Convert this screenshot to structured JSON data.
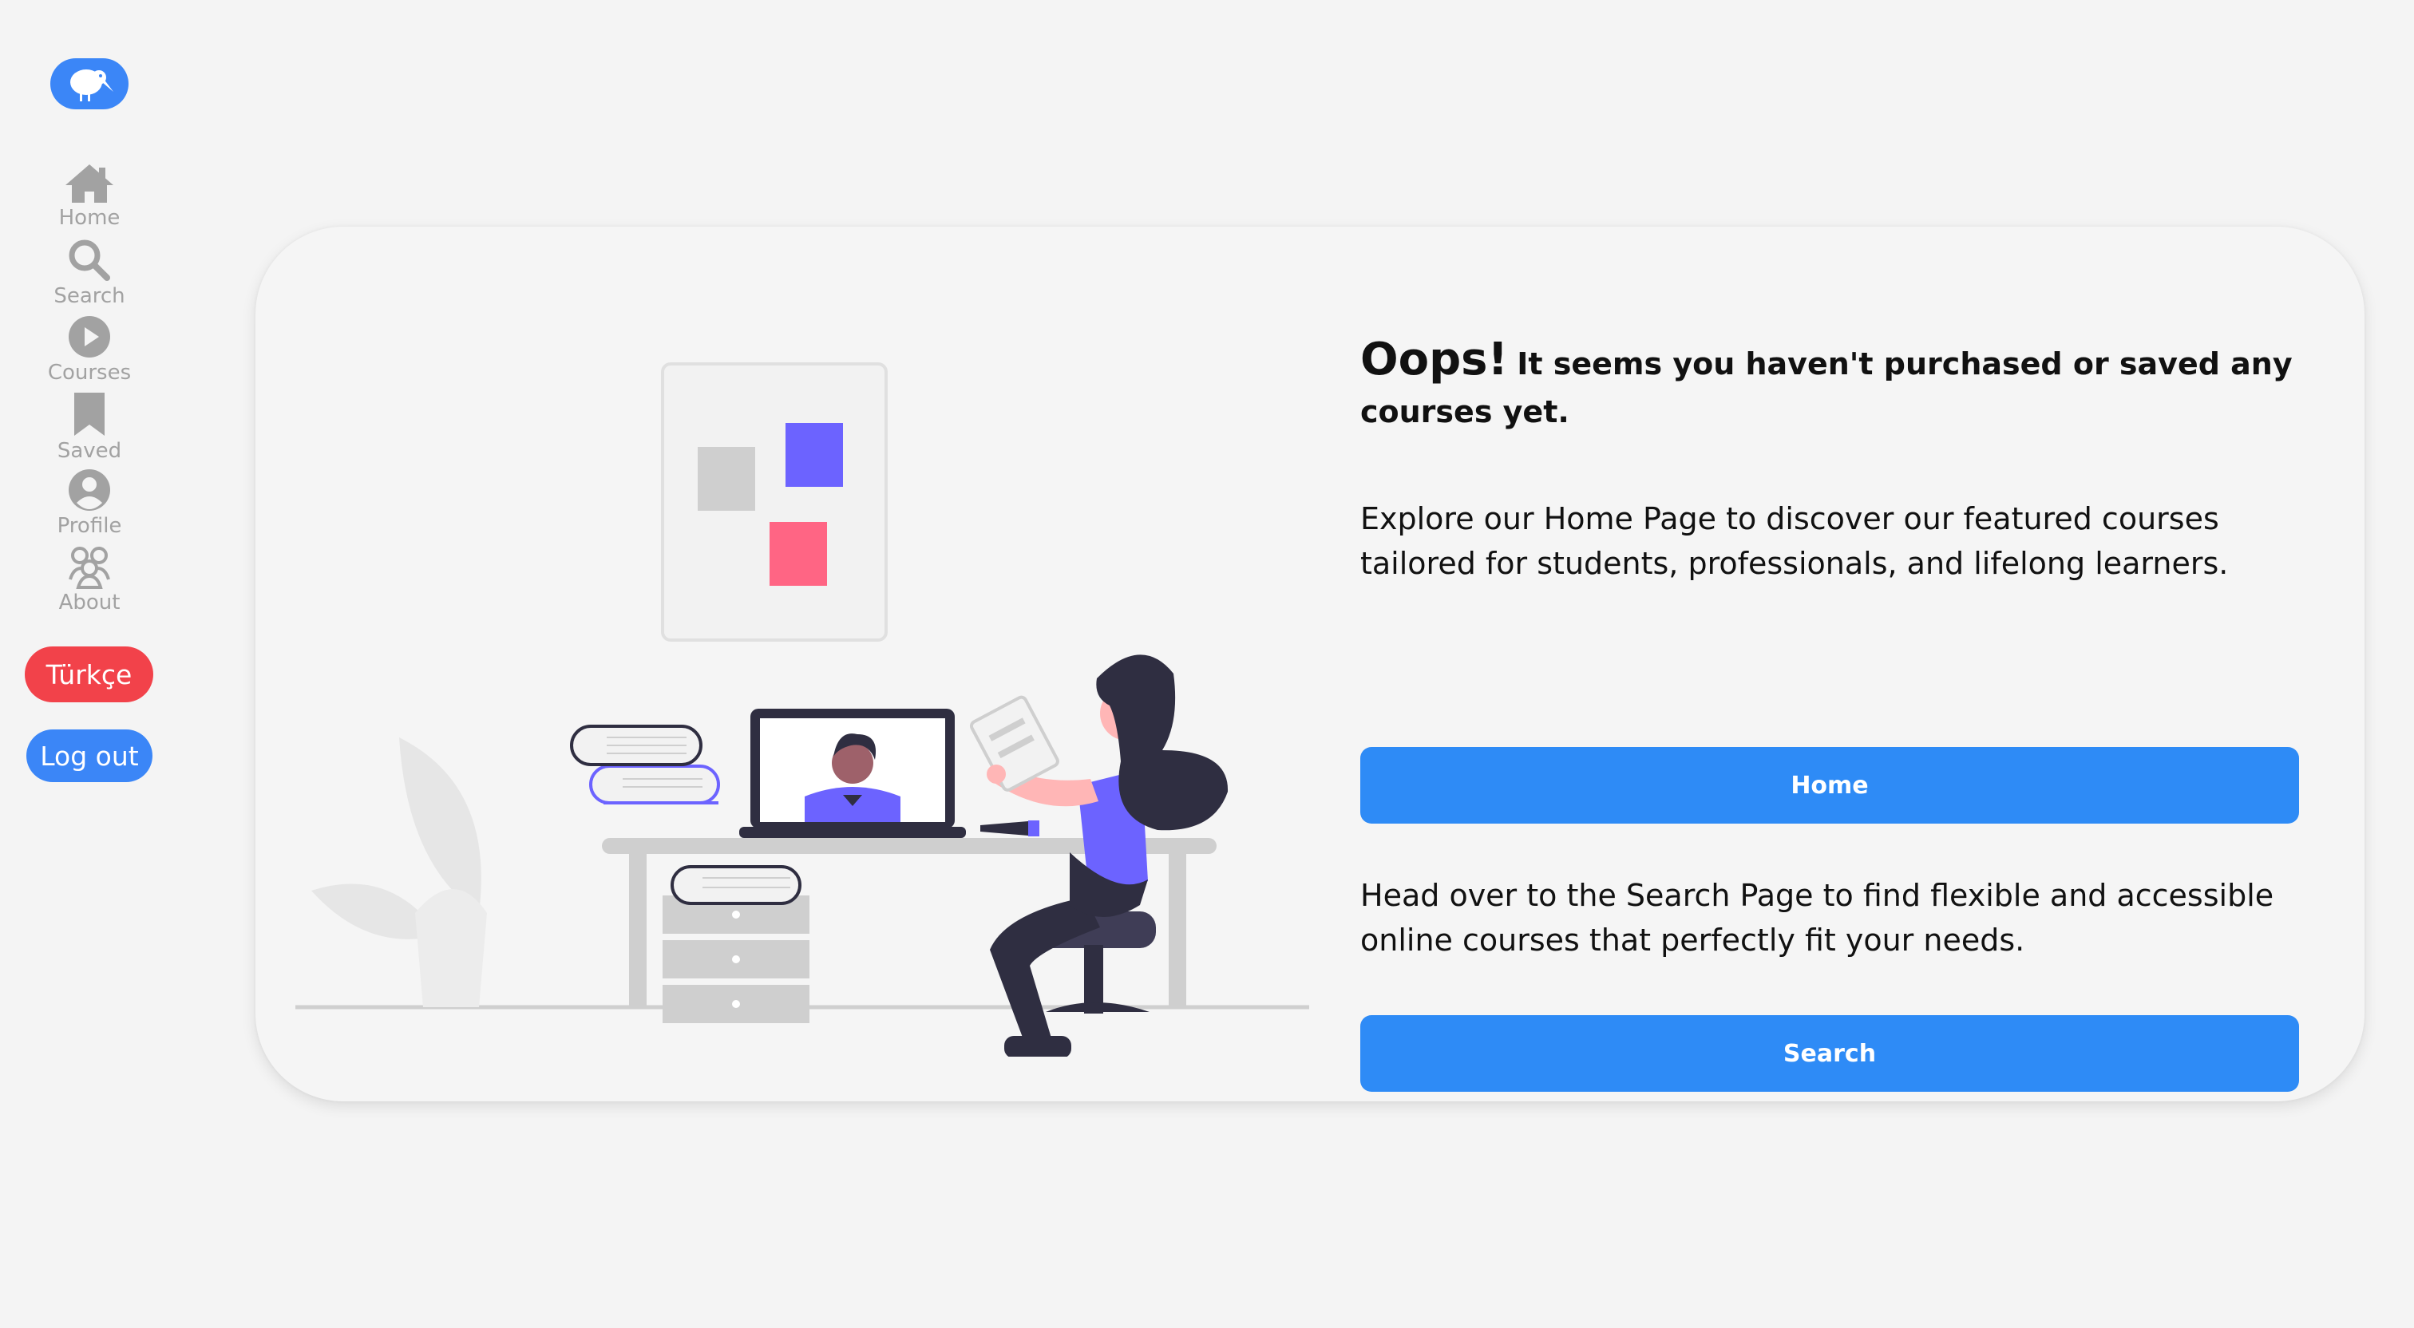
{
  "sidebar": {
    "logo_icon": "kiwi-bird-icon",
    "items": [
      {
        "label": "Home",
        "icon": "home-icon"
      },
      {
        "label": "Search",
        "icon": "search-icon"
      },
      {
        "label": "Courses",
        "icon": "play-circle-icon"
      },
      {
        "label": "Saved",
        "icon": "bookmark-icon"
      },
      {
        "label": "Profile",
        "icon": "user-circle-icon"
      },
      {
        "label": "About",
        "icon": "users-icon"
      }
    ],
    "language_button": "Türkçe",
    "logout_button": "Log out"
  },
  "main": {
    "headline_big": "Oops!",
    "headline_rest": "It seems you haven't purchased or saved any courses yet.",
    "home_text": "Explore our Home Page to discover our featured courses tailored for students, professionals, and lifelong learners.",
    "home_button": "Home",
    "search_text": "Head over to the Search Page to find flexible and accessible online courses that perfectly fit your needs.",
    "search_button": "Search"
  },
  "colors": {
    "accent": "#2e8bf6",
    "danger": "#f2424a",
    "icon_gray": "#a2a2a2",
    "illustration_purple": "#6c63ff",
    "illustration_pink": "#ff6584"
  }
}
